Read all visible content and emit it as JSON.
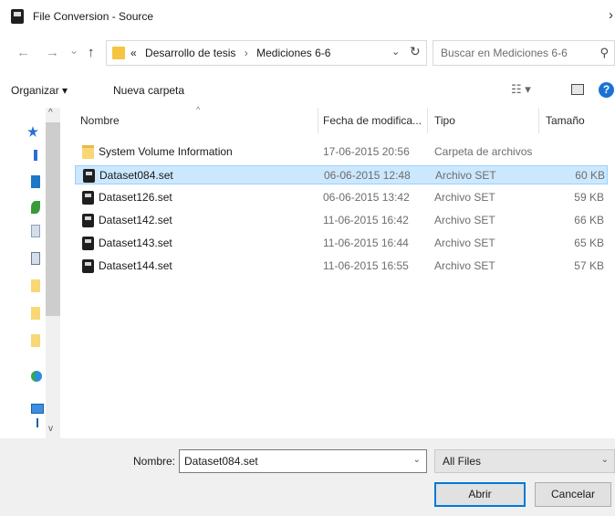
{
  "window": {
    "title": "File Conversion - Source",
    "title_chevron": "›"
  },
  "nav": {
    "back": "←",
    "forward": "→",
    "recent": "⌄",
    "up": "↑",
    "address": {
      "overflow": "«",
      "crumbs": [
        "Desarrollo de tesis",
        "Mediciones 6-6"
      ],
      "separator": "›",
      "dropdown": "⌄",
      "refresh": "↻"
    },
    "search_placeholder": "Buscar en Mediciones 6-6",
    "search_icon": "⚲"
  },
  "toolbar": {
    "organize": "Organizar ▾",
    "new_folder": "Nueva carpeta",
    "view": "☷ ▾",
    "help": "?"
  },
  "columns": {
    "name": "Nombre",
    "date": "Fecha de modifica...",
    "type": "Tipo",
    "size": "Tamaño",
    "sort_arrow": "^"
  },
  "files": [
    {
      "name": "System Volume Information",
      "date": "17-06-2015 20:56",
      "type": "Carpeta de archivos",
      "size": "",
      "kind": "folder",
      "selected": false
    },
    {
      "name": "Dataset084.set",
      "date": "06-06-2015 12:48",
      "type": "Archivo SET",
      "size": "60 KB",
      "kind": "set",
      "selected": true
    },
    {
      "name": "Dataset126.set",
      "date": "06-06-2015 13:42",
      "type": "Archivo SET",
      "size": "59 KB",
      "kind": "set",
      "selected": false
    },
    {
      "name": "Dataset142.set",
      "date": "11-06-2015 16:42",
      "type": "Archivo SET",
      "size": "66 KB",
      "kind": "set",
      "selected": false
    },
    {
      "name": "Dataset143.set",
      "date": "11-06-2015 16:44",
      "type": "Archivo SET",
      "size": "65 KB",
      "kind": "set",
      "selected": false
    },
    {
      "name": "Dataset144.set",
      "date": "11-06-2015 16:55",
      "type": "Archivo SET",
      "size": "57 KB",
      "kind": "set",
      "selected": false
    }
  ],
  "footer": {
    "filename_label": "Nombre:",
    "filename_value": "Dataset084.set",
    "filter_value": "All Files",
    "open_label": "Abrir",
    "cancel_label": "Cancelar",
    "dropdown_glyph": "⌄"
  },
  "sidebar": {
    "scroll_up": "^",
    "scroll_down": "v"
  },
  "colors": {
    "selection_fill": "#cce8ff",
    "selection_border": "#99d1ff",
    "folder": "#f8d775",
    "help_blue": "#1a73d2",
    "default_button_border": "#0078d7"
  }
}
